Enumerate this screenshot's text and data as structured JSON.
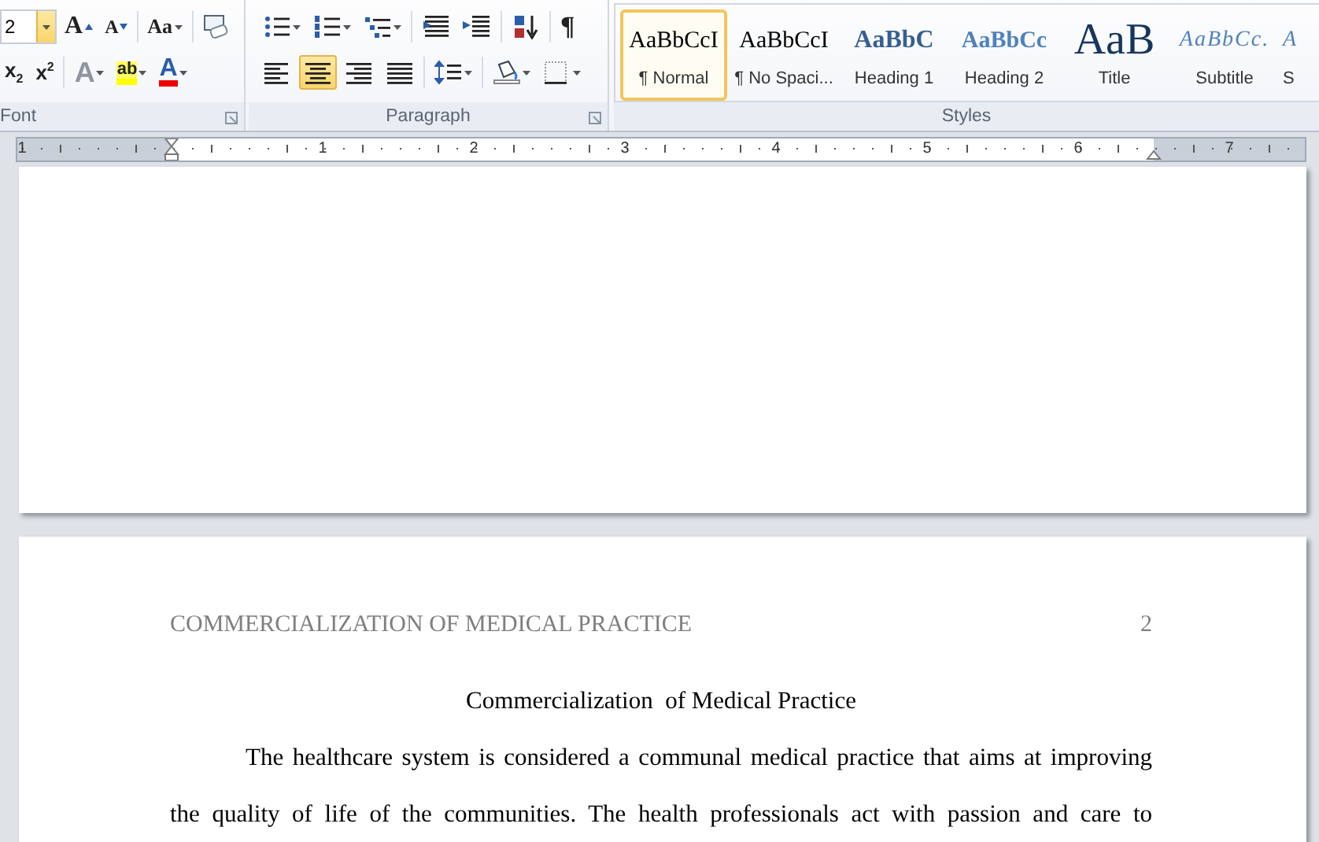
{
  "ribbon": {
    "font": {
      "label": "Font",
      "size_value": "2",
      "row1": [
        {
          "kind": "grow",
          "label": "A"
        },
        {
          "kind": "shrink",
          "label": "A"
        },
        {
          "kind": "case",
          "label": "Aa"
        },
        {
          "kind": "clear"
        }
      ],
      "row2": [
        {
          "kind": "subscript",
          "label": "x$_{2}$"
        },
        {
          "kind": "superscript",
          "label": "x$^{2}$"
        },
        {
          "kind": "effects",
          "label": "A",
          "disabled": true
        },
        {
          "kind": "highlight",
          "label": "ab",
          "disabled": false
        },
        {
          "kind": "color",
          "label": "A",
          "disabled": false
        }
      ]
    },
    "paragraph": {
      "label": "Paragraph",
      "row1": [
        {
          "kind": "bullets"
        },
        {
          "kind": "numbering"
        },
        {
          "kind": "multilevel"
        },
        {
          "kind": "outdent"
        },
        {
          "kind": "indent"
        },
        {
          "kind": "sort"
        },
        {
          "kind": "pilcrow",
          "label": "¶"
        }
      ],
      "alignment": [
        {
          "kind": "left",
          "selected": false
        },
        {
          "kind": "center",
          "selected": true
        },
        {
          "kind": "right",
          "selected": false
        },
        {
          "kind": "justify",
          "selected": false
        }
      ],
      "row2": [
        {
          "kind": "spacing"
        },
        {
          "kind": "shading"
        },
        {
          "kind": "borders"
        }
      ]
    },
    "styles": {
      "label": "Styles",
      "items": [
        {
          "preview": "AaBbCcI",
          "name": "¶ Normal",
          "kind": "normal",
          "selected": true
        },
        {
          "preview": "AaBbCcI",
          "name": "¶ No Spaci...",
          "kind": "normal",
          "selected": false
        },
        {
          "preview": "AaBbC",
          "name": "Heading 1",
          "kind": "heading1",
          "selected": false
        },
        {
          "preview": "AaBbCc",
          "name": "Heading 2",
          "kind": "heading2",
          "selected": false
        },
        {
          "preview": "AaB",
          "name": "Title",
          "kind": "title",
          "selected": false
        },
        {
          "preview": "AaBbCc.",
          "name": "Subtitle",
          "kind": "subtitle",
          "selected": false
        },
        {
          "preview": "A",
          "name": "S",
          "kind": "subtitle",
          "selected": false
        }
      ]
    }
  },
  "ruler": {
    "numbers": [
      "1",
      "1",
      "2",
      "3",
      "4",
      "5",
      "6",
      "7"
    ]
  },
  "page2": {
    "header": "COMMERCIALIZATION OF MEDICAL PRACTICE",
    "page_number": "2",
    "title": "Commercialization  of Medical Practice",
    "lines": [
      "The healthcare system is considered a communal medical practice that aims at improving",
      "the quality of life of the communities. The health professionals act with passion and care to"
    ]
  }
}
